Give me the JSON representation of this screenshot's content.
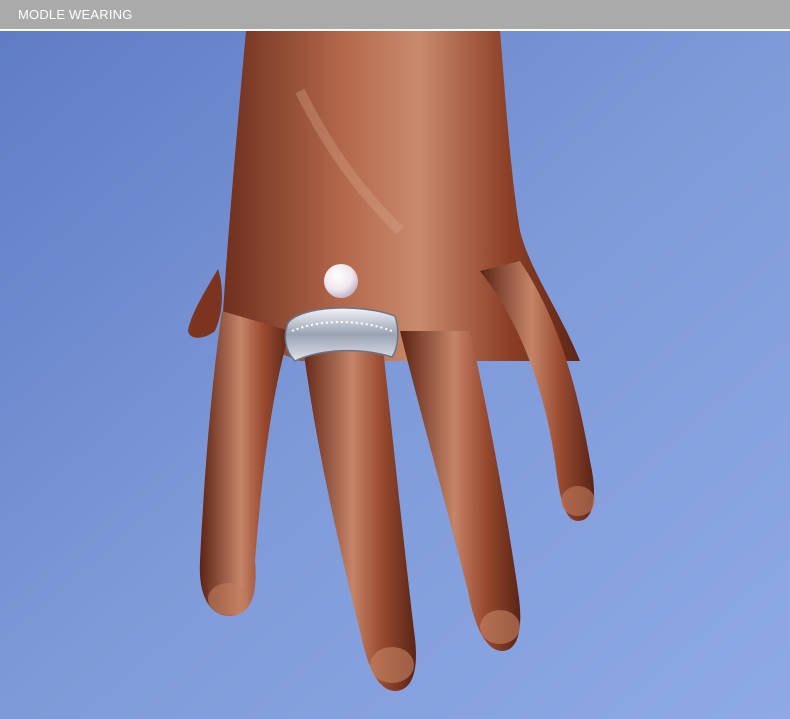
{
  "header": {
    "title": "MODLE WEARING",
    "background_color": "#aaaaaa",
    "text_color": "#ffffff"
  },
  "photo": {
    "subject_icon": "mannequin-hand-with-pearl-ring-image",
    "background_color": "#7c97d6",
    "hand_color": "#9a4a2e",
    "ring_color": "#d9dde6",
    "pearl_color": "#f4eef2"
  }
}
